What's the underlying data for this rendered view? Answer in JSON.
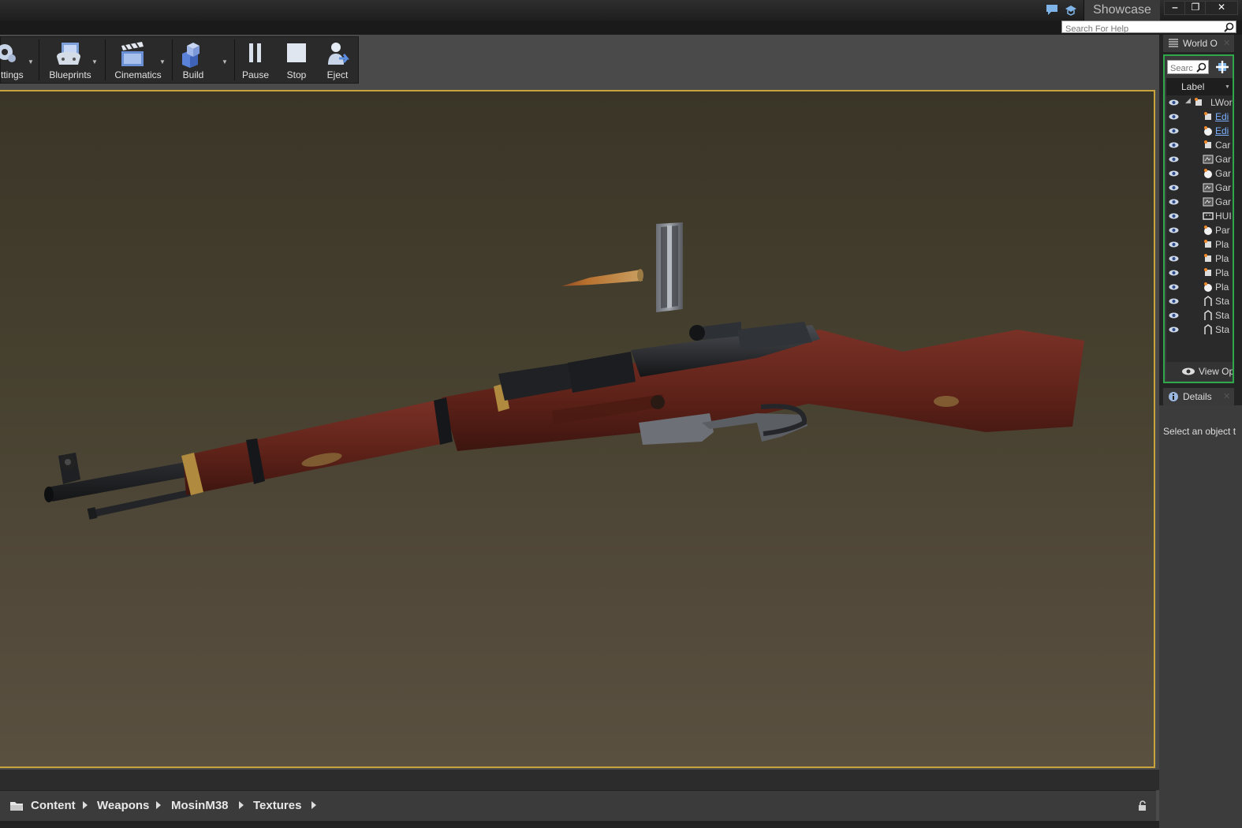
{
  "window": {
    "project_tab": "Showcase",
    "help_search_placeholder": "Search For Help",
    "minimize": "‒",
    "restore": "❐",
    "close": "✕"
  },
  "toolbar": {
    "items": [
      {
        "label": "ttings",
        "icon": "settings-icon"
      },
      {
        "label": "Blueprints",
        "icon": "blueprints-icon"
      },
      {
        "label": "Cinematics",
        "icon": "cinematics-icon"
      },
      {
        "label": "Build",
        "icon": "build-icon"
      },
      {
        "label": "Pause",
        "icon": "pause-icon"
      },
      {
        "label": "Stop",
        "icon": "stop-icon"
      },
      {
        "label": "Eject",
        "icon": "eject-icon"
      }
    ]
  },
  "viewport": {
    "subject": "Mosin M38 rifle with cartridge and stripper clip",
    "border_color": "#c9a33c"
  },
  "content_browser": {
    "breadcrumbs": [
      "Content",
      "Weapons",
      "MosinM38",
      "Textures"
    ]
  },
  "world_outliner": {
    "tab_title": "World O",
    "search_placeholder": "Searc",
    "column_label": "Label",
    "rows": [
      {
        "label": "LWor",
        "icon": "world-icon",
        "link": false,
        "root": true
      },
      {
        "label": "Edi",
        "icon": "editor-actor-icon",
        "link": true
      },
      {
        "label": "Edi",
        "icon": "editor-sphere-icon",
        "link": true
      },
      {
        "label": "Car",
        "icon": "camera-icon",
        "link": false
      },
      {
        "label": "Gar",
        "icon": "game-mode-icon",
        "link": false
      },
      {
        "label": "Gar",
        "icon": "game-state-icon",
        "link": false
      },
      {
        "label": "Gar",
        "icon": "game-network-icon",
        "link": false
      },
      {
        "label": "Gar",
        "icon": "game-session-icon",
        "link": false
      },
      {
        "label": "HUI",
        "icon": "hud-icon",
        "link": false
      },
      {
        "label": "Par",
        "icon": "particle-icon",
        "link": false
      },
      {
        "label": "Pla",
        "icon": "player-controller-icon",
        "link": false
      },
      {
        "label": "Pla",
        "icon": "player-camera-icon",
        "link": false
      },
      {
        "label": "Pla",
        "icon": "player-pawn-icon",
        "link": false
      },
      {
        "label": "Pla",
        "icon": "player-state-icon",
        "link": false
      },
      {
        "label": "Sta",
        "icon": "static-mesh-icon",
        "link": false
      },
      {
        "label": "Sta",
        "icon": "static-mesh-icon",
        "link": false
      },
      {
        "label": "Sta",
        "icon": "static-mesh-icon",
        "link": false
      }
    ],
    "view_options": "View Op",
    "accent": "#2ea84a"
  },
  "details": {
    "tab_title": "Details",
    "empty_text": "Select an object t"
  }
}
